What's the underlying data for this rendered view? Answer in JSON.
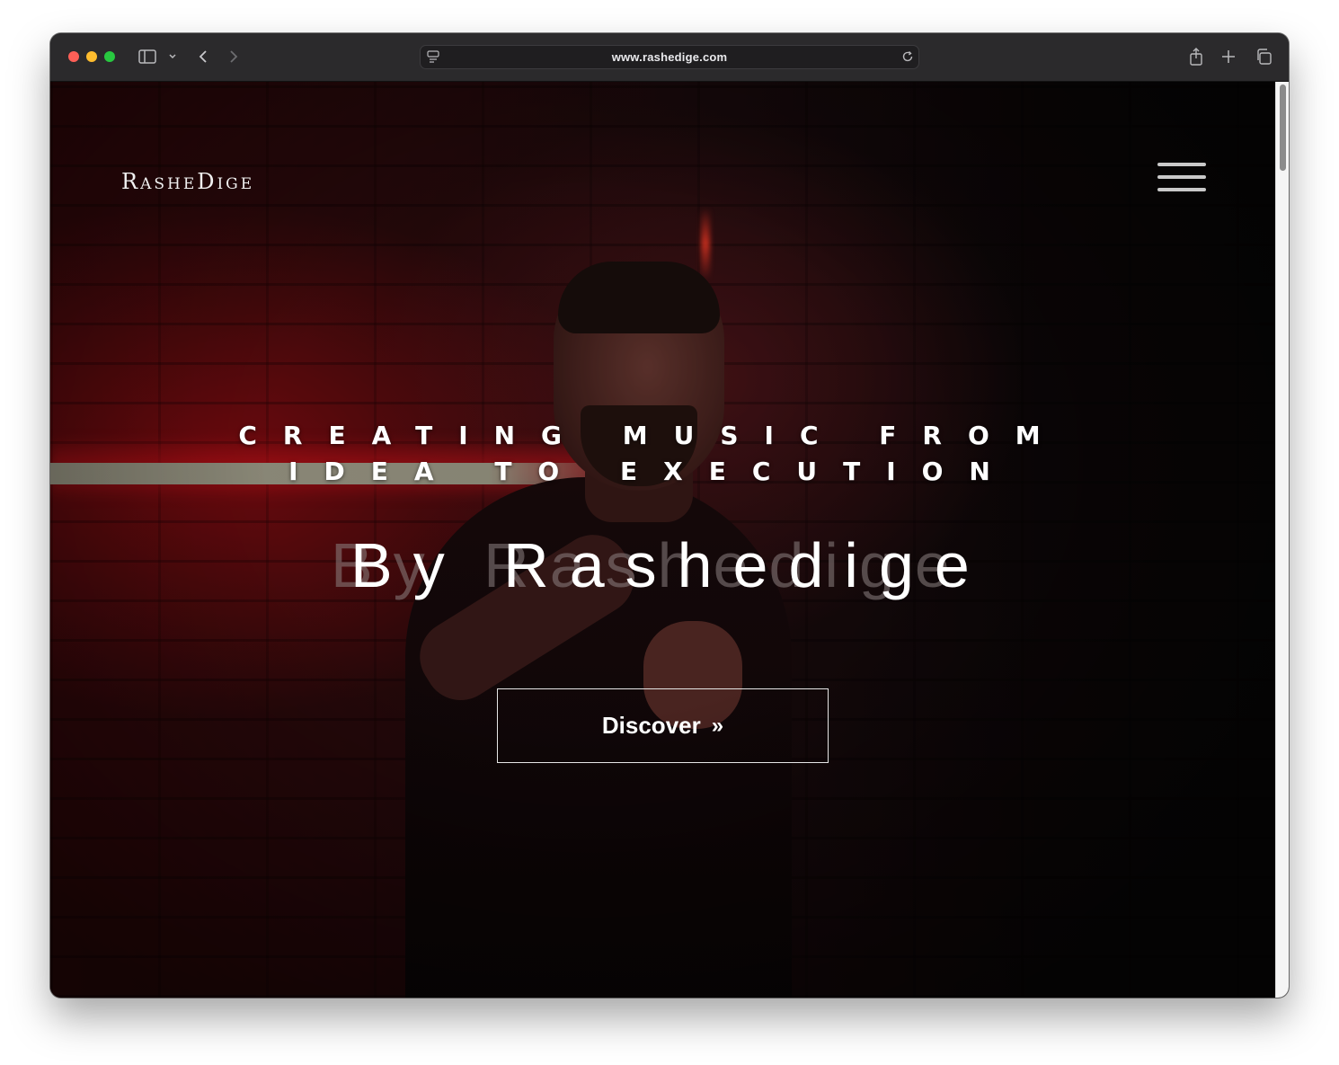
{
  "browser": {
    "url": "www.rashedige.com"
  },
  "site": {
    "logo": "RasheDige",
    "tagline": "CREATING MUSIC FROM\nIDEA TO EXECUTION",
    "byline": "By Rashedige",
    "discover_label": "Discover",
    "discover_icon": "»"
  },
  "colors": {
    "background": "#0b0708",
    "accent_red": "#c0141c",
    "text": "#ffffff"
  }
}
